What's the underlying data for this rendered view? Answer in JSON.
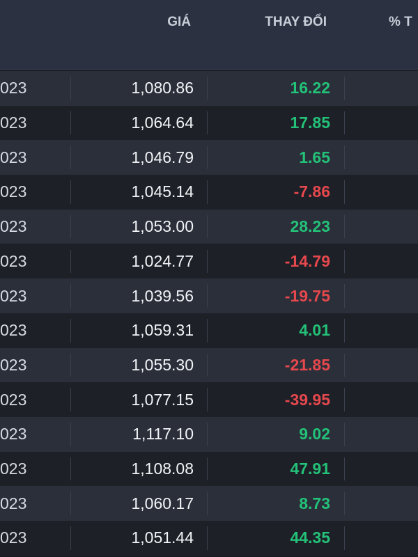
{
  "header": {
    "price_label": "GIÁ",
    "change_label": "THAY ĐỔI",
    "pct_label": "% T"
  },
  "colors": {
    "up": "#24c178",
    "down": "#e5484d",
    "header_bg": "#2b3140",
    "row_odd_bg": "#2a2f3a",
    "row_even_bg": "#1d2027"
  },
  "rows": [
    {
      "date": "023",
      "price": "1,080.86",
      "change": "16.22",
      "direction": "up"
    },
    {
      "date": "023",
      "price": "1,064.64",
      "change": "17.85",
      "direction": "up"
    },
    {
      "date": "023",
      "price": "1,046.79",
      "change": "1.65",
      "direction": "up"
    },
    {
      "date": "023",
      "price": "1,045.14",
      "change": "-7.86",
      "direction": "down"
    },
    {
      "date": "023",
      "price": "1,053.00",
      "change": "28.23",
      "direction": "up"
    },
    {
      "date": "023",
      "price": "1,024.77",
      "change": "-14.79",
      "direction": "down"
    },
    {
      "date": "023",
      "price": "1,039.56",
      "change": "-19.75",
      "direction": "down"
    },
    {
      "date": "023",
      "price": "1,059.31",
      "change": "4.01",
      "direction": "up"
    },
    {
      "date": "023",
      "price": "1,055.30",
      "change": "-21.85",
      "direction": "down"
    },
    {
      "date": "023",
      "price": "1,077.15",
      "change": "-39.95",
      "direction": "down"
    },
    {
      "date": "023",
      "price": "1,117.10",
      "change": "9.02",
      "direction": "up"
    },
    {
      "date": "023",
      "price": "1,108.08",
      "change": "47.91",
      "direction": "up"
    },
    {
      "date": "023",
      "price": "1,060.17",
      "change": "8.73",
      "direction": "up"
    },
    {
      "date": "023",
      "price": "1,051.44",
      "change": "44.35",
      "direction": "up"
    }
  ]
}
